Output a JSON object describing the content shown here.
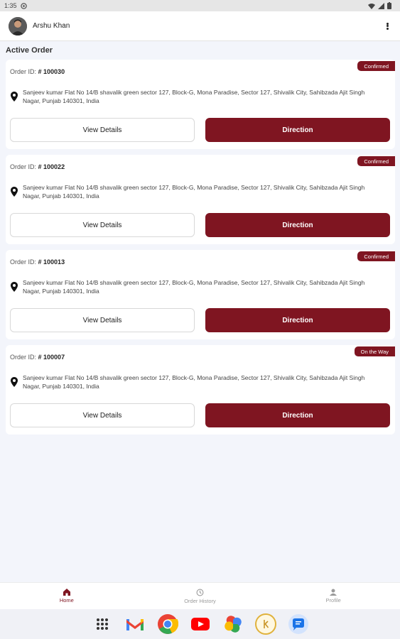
{
  "status_bar": {
    "time": "1:35"
  },
  "header": {
    "user_name": "Arshu Khan"
  },
  "section_title": "Active Order",
  "order_id_label": "Order ID:",
  "orders": [
    {
      "id": "# 100030",
      "status": "Confirmed",
      "address": "Sanjeev kumar Flat No 14/B shavalik green sector 127, Block-G, Mona Paradise, Sector 127, Shivalik City, Sahibzada Ajit Singh Nagar, Punjab 140301, India",
      "view_label": "View Details",
      "direction_label": "Direction"
    },
    {
      "id": "# 100022",
      "status": "Confirmed",
      "address": "Sanjeev kumar Flat No 14/B shavalik green sector 127, Block-G, Mona Paradise, Sector 127, Shivalik City, Sahibzada Ajit Singh Nagar, Punjab 140301, India",
      "view_label": "View Details",
      "direction_label": "Direction"
    },
    {
      "id": "# 100013",
      "status": "Confirmed",
      "address": "Sanjeev kumar Flat No 14/B shavalik green sector 127, Block-G, Mona Paradise, Sector 127, Shivalik City, Sahibzada Ajit Singh Nagar, Punjab 140301, India",
      "view_label": "View Details",
      "direction_label": "Direction"
    },
    {
      "id": "# 100007",
      "status": "On the Way",
      "address": "Sanjeev kumar Flat No 14/B shavalik green sector 127, Block-G, Mona Paradise, Sector 127, Shivalik City, Sahibzada Ajit Singh Nagar, Punjab 140301, India",
      "view_label": "View Details",
      "direction_label": "Direction"
    }
  ],
  "bottom_nav": [
    {
      "label": "Home",
      "icon": "home-icon",
      "active": true
    },
    {
      "label": "Order History",
      "icon": "history-icon",
      "active": false
    },
    {
      "label": "Profile",
      "icon": "person-icon",
      "active": false
    }
  ],
  "dock_apps": [
    "app-grid-icon",
    "gmail-icon",
    "chrome-icon",
    "youtube-icon",
    "photos-icon",
    "clock-app-icon",
    "messages-icon"
  ],
  "colors": {
    "accent": "#7f1521",
    "background": "#f3f5fb"
  }
}
